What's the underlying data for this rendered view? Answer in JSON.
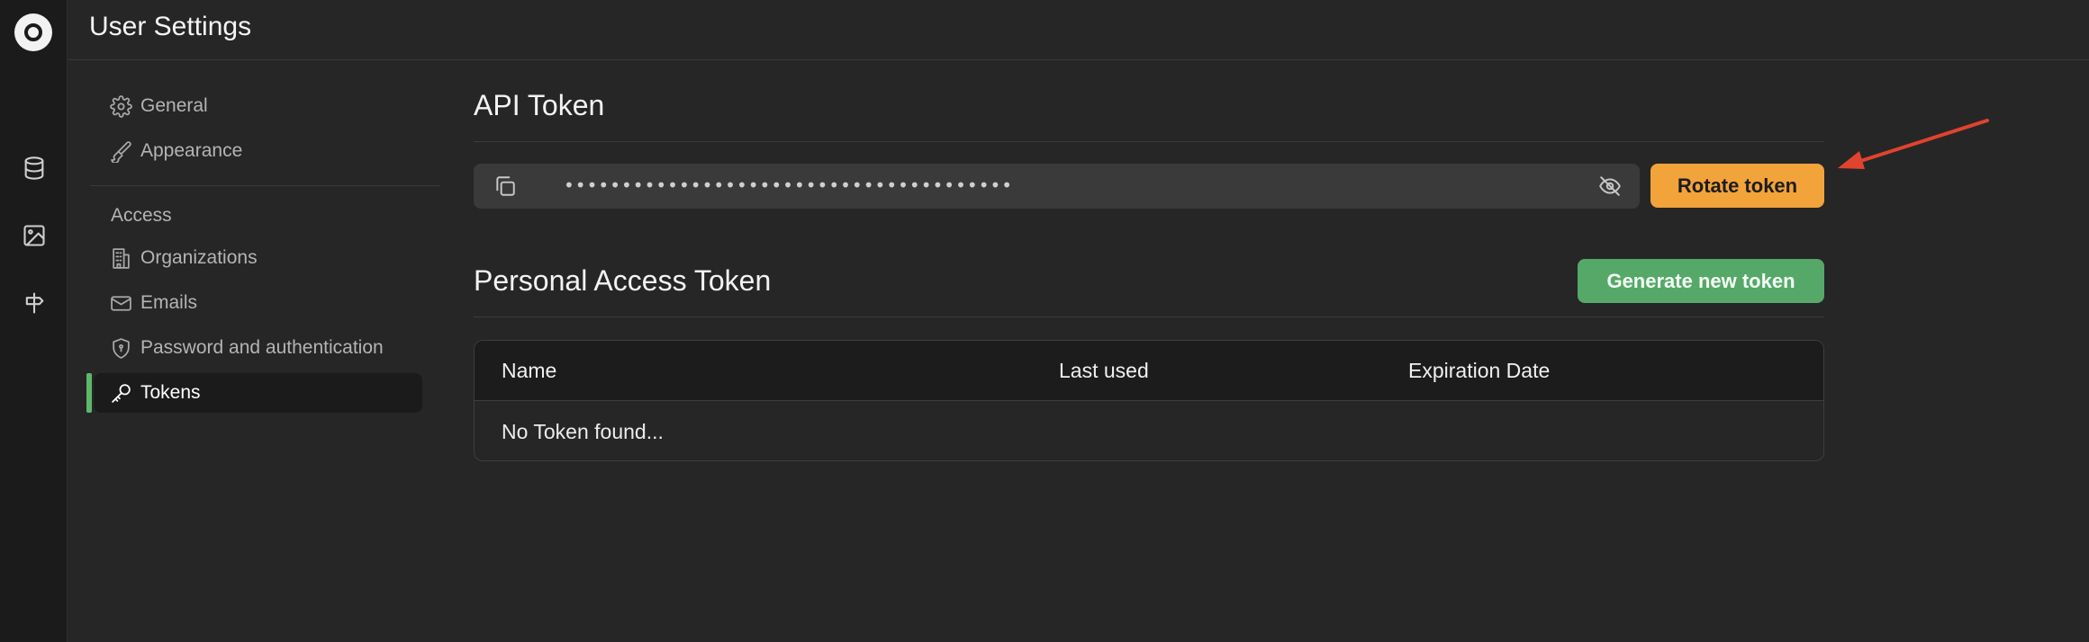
{
  "header": {
    "title": "User Settings"
  },
  "rail": {
    "icons": [
      "logo",
      "database-icon",
      "image-icon",
      "signpost-icon"
    ]
  },
  "nav": {
    "items_top": [
      {
        "label": "General",
        "icon": "gear-icon"
      },
      {
        "label": "Appearance",
        "icon": "brush-icon"
      }
    ],
    "section_label": "Access",
    "items_access": [
      {
        "label": "Organizations",
        "icon": "building-icon"
      },
      {
        "label": "Emails",
        "icon": "mail-icon"
      },
      {
        "label": "Password and authentication",
        "icon": "shield-icon"
      },
      {
        "label": "Tokens",
        "icon": "key-icon",
        "active": true
      }
    ]
  },
  "api_token": {
    "title": "API Token",
    "masked_value": "•••••••••••••••••••••••••••••••••••••••",
    "rotate_label": "Rotate token"
  },
  "personal_tokens": {
    "title": "Personal Access Token",
    "generate_label": "Generate new token",
    "columns": [
      "Name",
      "Last used",
      "Expiration Date"
    ],
    "empty_text": "No Token found..."
  },
  "colors": {
    "accent_active": "#5cb86a",
    "rotate_button": "#f2a33a",
    "generate_button": "#56a869",
    "annotation_arrow": "#e0432e"
  }
}
